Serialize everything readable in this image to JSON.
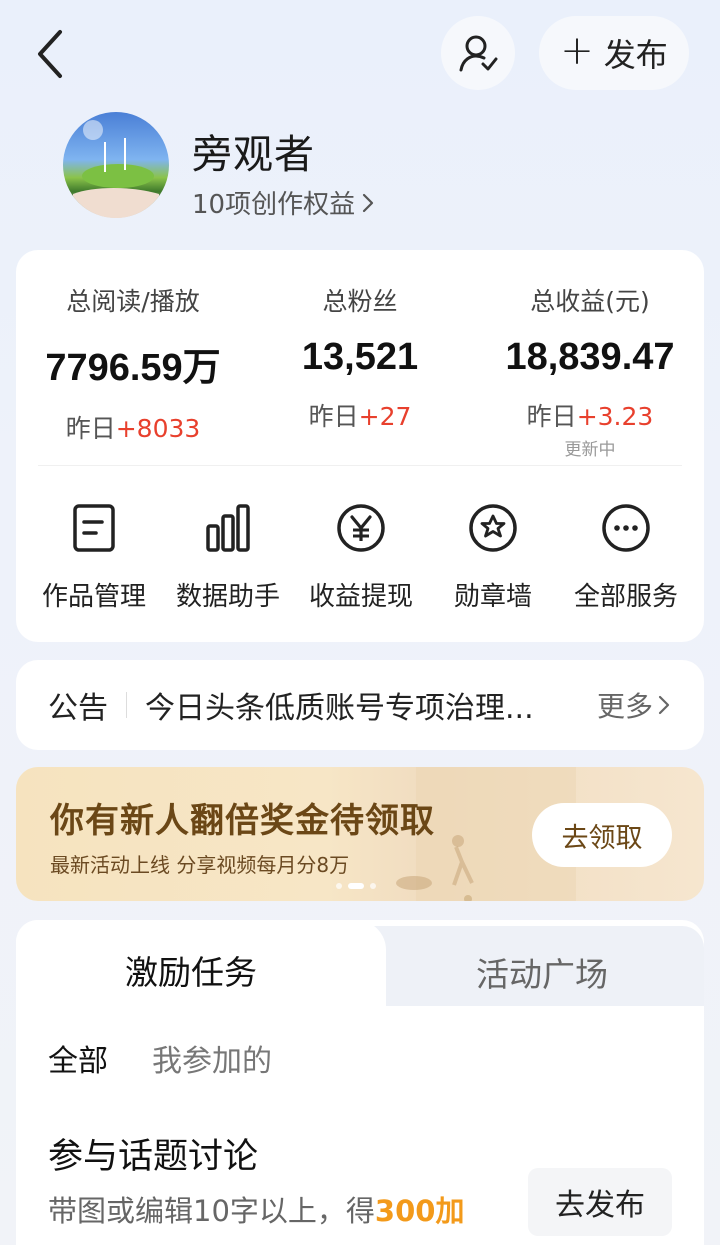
{
  "header": {
    "publish_label": "发布"
  },
  "profile": {
    "name": "旁观者",
    "rights_link": "10项创作权益"
  },
  "stats": [
    {
      "label": "总阅读/播放",
      "value": "7796.59万",
      "delta_prefix": "昨日",
      "delta": "+8033"
    },
    {
      "label": "总粉丝",
      "value": "13,521",
      "delta_prefix": "昨日",
      "delta": "+27"
    },
    {
      "label": "总收益(元)",
      "value": "18,839.47",
      "delta_prefix": "昨日",
      "delta": "+3.23",
      "note": "更新中"
    }
  ],
  "services": [
    {
      "label": "作品管理",
      "icon": "document-icon"
    },
    {
      "label": "数据助手",
      "icon": "bar-chart-icon"
    },
    {
      "label": "收益提现",
      "icon": "yuan-icon"
    },
    {
      "label": "勋章墙",
      "icon": "medal-icon"
    },
    {
      "label": "全部服务",
      "icon": "more-icon"
    }
  ],
  "notice": {
    "tag": "公告",
    "text": "今日头条低质账号专项治理...",
    "more": "更多"
  },
  "banner": {
    "title": "你有新人翻倍奖金待领取",
    "subtitle": "最新活动上线 分享视频每月分8万",
    "button": "去领取"
  },
  "tabs": {
    "active": "激励任务",
    "other": "活动广场"
  },
  "filters": {
    "all": "全部",
    "mine": "我参加的"
  },
  "task": {
    "title": "参与话题讨论",
    "desc_prefix": "带图或编辑10字以上，得",
    "desc_highlight": "300加",
    "button": "去发布"
  },
  "colors": {
    "accent_red": "#e8402d",
    "accent_orange": "#f39a1a",
    "banner_text": "#6b4716"
  }
}
